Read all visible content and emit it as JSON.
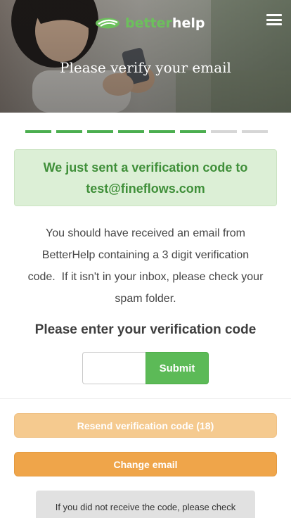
{
  "header": {
    "logo": {
      "part1": "better",
      "part2": "help",
      "accent_color": "#6cc05c"
    },
    "menu_icon": "hamburger-icon",
    "title": "Please verify your email"
  },
  "progress": {
    "completed_steps": 6,
    "total_steps": 8,
    "active_color": "#4bae4f",
    "inactive_color": "#d6d6d6"
  },
  "notice": {
    "line1": "We just sent a verification code to",
    "email": "test@fineflows.com",
    "bg_color": "#dcefd6",
    "text_color": "#3f8f39"
  },
  "info": {
    "line1": "You should have received an email from",
    "line2": "BetterHelp containing a 3 digit verification",
    "line3": "code.  If it isn't in your inbox, please check your",
    "line4": "spam folder."
  },
  "form": {
    "prompt": "Please enter your verification code",
    "code_value": "",
    "code_placeholder": "",
    "submit_label": "Submit",
    "submit_color": "#5cba57"
  },
  "actions": {
    "resend_label": "Resend verification code (18)",
    "resend_color": "#f5ca8f",
    "change_label": "Change email",
    "change_color": "#efa54a"
  },
  "help": {
    "text": "If you did not receive the code, please check"
  }
}
